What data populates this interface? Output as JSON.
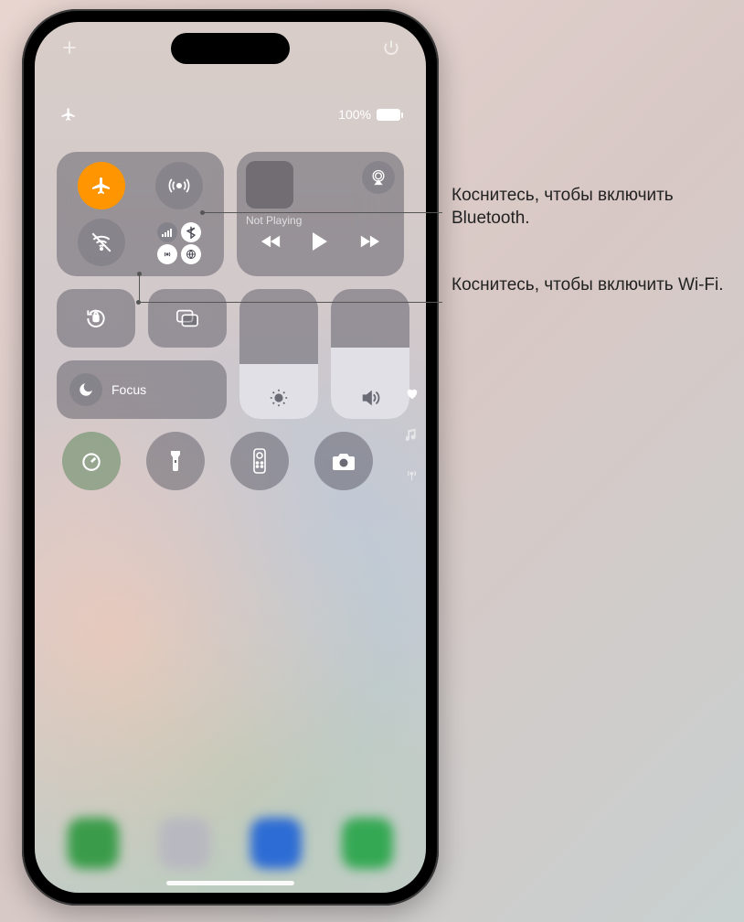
{
  "status": {
    "battery_text": "100%"
  },
  "media": {
    "now_playing": "Not Playing"
  },
  "focus": {
    "label": "Focus"
  },
  "brightness": {
    "level_pct": 42
  },
  "volume": {
    "level_pct": 55
  },
  "icons": {
    "add": "plus-icon",
    "power": "power-icon",
    "airplane_status": "airplane-icon",
    "airplane": "airplane-icon",
    "airdrop": "airdrop-icon",
    "wifi_off": "wifi-slash-icon",
    "cellular": "cellular-icon",
    "bluetooth": "bluetooth-icon",
    "hotspot": "hotspot-icon",
    "vpn": "vpn-icon",
    "airplay_audio": "airplay-icon",
    "prev": "backward-icon",
    "play": "play-icon",
    "next": "forward-icon",
    "orientation": "orientation-lock-icon",
    "mirroring": "screen-mirroring-icon",
    "moon": "moon-icon",
    "brightness": "sun-icon",
    "volume": "speaker-icon",
    "timer": "timer-icon",
    "flashlight": "flashlight-icon",
    "remote": "remote-icon",
    "camera": "camera-icon",
    "heart": "heart-icon",
    "music": "music-note-icon",
    "radio": "antenna-icon"
  },
  "callouts": {
    "bluetooth": "Коснитесь, чтобы включить Bluetooth.",
    "wifi": "Коснитесь, чтобы включить Wi-Fi."
  }
}
